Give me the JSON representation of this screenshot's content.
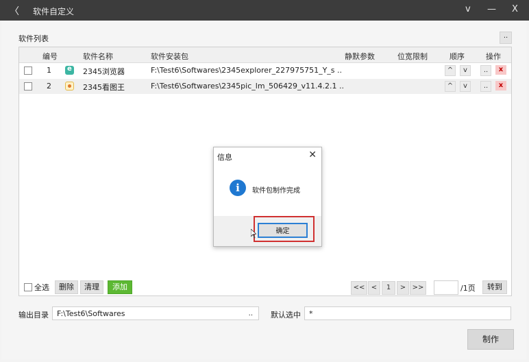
{
  "window": {
    "title": "软件自定义",
    "controls": {
      "back": "〈",
      "dropdown": "v",
      "minimize": "—",
      "close": "X"
    }
  },
  "software_list": {
    "section_label": "软件列表",
    "more_label": "..",
    "columns": [
      "编号",
      "软件名称",
      "软件安装包",
      "静默参数",
      "位宽限制",
      "顺序",
      "操作"
    ],
    "rows": [
      {
        "index": "1",
        "name": "2345浏览器",
        "icon": "browser-icon",
        "package": "F:\\Test6\\Softwares\\2345explorer_227975751_Y_s ..",
        "silent": "",
        "bits": "",
        "up": "^",
        "down": "v",
        "edit": "..",
        "remove": "x"
      },
      {
        "index": "2",
        "name": "2345看图王",
        "icon": "image-viewer-icon",
        "package": "F:\\Test6\\Softwares\\2345pic_lm_506429_v11.4.2.1 ..",
        "silent": "",
        "bits": "",
        "up": "^",
        "down": "v",
        "edit": "..",
        "remove": "x"
      }
    ]
  },
  "bottom_actions": {
    "select_all": "全选",
    "delete": "删除",
    "clear": "清理",
    "add": "添加"
  },
  "pagination": {
    "first": "<<",
    "prev": "<",
    "current": "1",
    "next": ">",
    "last": ">>",
    "page_input": "",
    "total": "/1页",
    "goto": "转到"
  },
  "output": {
    "dir_label": "输出目录",
    "dir_value": "F:\\Test6\\Softwares",
    "dir_browse": "..",
    "default_label": "默认选中",
    "default_value": "*"
  },
  "make_button": "制作",
  "dialog": {
    "title": "信息",
    "close": "✕",
    "icon": "info-icon",
    "message": "软件包制作完成",
    "ok": "确定"
  },
  "colors": {
    "titlebar": "#3c3c3c",
    "add_button": "#5cb833",
    "remove_button": "#f8c8c8",
    "highlight": "#d03030",
    "info_icon": "#1f78d1"
  }
}
